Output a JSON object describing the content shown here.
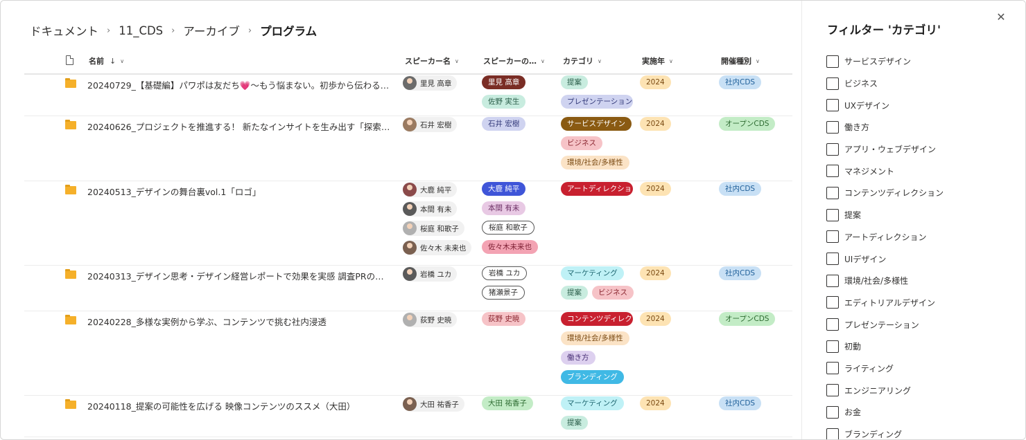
{
  "breadcrumb": [
    "ドキュメント",
    "11_CDS",
    "アーカイブ",
    "プログラム"
  ],
  "columns": {
    "name": "名前",
    "speaker": "スピーカー名",
    "speaker2": "スピーカーの…",
    "category": "カテゴリ",
    "year": "実施年",
    "type": "開催種別"
  },
  "icons": {
    "sort": "arrow-down-icon",
    "chevron": "chevron-down-icon",
    "file": "file-icon",
    "folder": "folder-icon",
    "close": "close-icon"
  },
  "colors": {
    "brown": "#7a2d25",
    "mint": "#c8ecdf",
    "lavender": "#cfd3f0",
    "gold": "#8a5a12",
    "pink": "#f6c3c7",
    "peach": "#fbe3c6",
    "red": "#c8202f",
    "blue": "#3f55d8",
    "mauve": "#e8c9e4",
    "rose": "#f3a3b3",
    "cyan": "#bff1f6",
    "teal": "#40b9e5",
    "lightblue": "#c8e0f5",
    "green": "#c3ecc6",
    "yellow": "#fde3b3",
    "lilac": "#ddd0ef"
  },
  "rows": [
    {
      "name": "20240729_【基礎編】パワポは友だち💗〜もう悩まない。初歩から伝わる資料作成術〜",
      "speakers": [
        "里見 高章"
      ],
      "speakers2": [
        {
          "label": "里見 高章",
          "bg": "#7a2d25",
          "fg": "#ffffff"
        },
        {
          "label": "佐野 実生",
          "bg": "#c8ecdf",
          "fg": "#2b5e4a"
        }
      ],
      "categories": [
        {
          "label": "提案",
          "bg": "#c8ecdf",
          "fg": "#2b5e4a"
        },
        {
          "label": "プレゼンテーション",
          "bg": "#cfd3f0",
          "fg": "#333a7a"
        }
      ],
      "year": "2024",
      "type": "社内CDS",
      "type_bg": "#c8e0f5",
      "type_fg": "#1f5f99"
    },
    {
      "name": "20240626_プロジェクトを推進する！ 新たなインサイトを生み出す「探索型リサーチ」",
      "speakers": [
        "石井 宏樹"
      ],
      "speakers2": [
        {
          "label": "石井 宏樹",
          "bg": "#cfd3f0",
          "fg": "#333a7a"
        }
      ],
      "categories": [
        {
          "label": "サービスデザイン",
          "bg": "#8a5a12",
          "fg": "#ffffff"
        },
        {
          "label": "ビジネス",
          "bg": "#f6c3c7",
          "fg": "#8a2630"
        },
        {
          "label": "環境/社会/多様性",
          "bg": "#fbe3c6",
          "fg": "#7a4a12"
        }
      ],
      "year": "2024",
      "type": "オープンCDS",
      "type_bg": "#c3ecc6",
      "type_fg": "#2d6b31"
    },
    {
      "name": "20240513_デザインの舞台裏vol.1「ロゴ」",
      "speakers": [
        "大鹿 純平",
        "本間 有未",
        "桜庭 和歌子",
        "佐々木 未来也"
      ],
      "speakers2": [
        {
          "label": "大鹿 純平",
          "bg": "#3f55d8",
          "fg": "#ffffff"
        },
        {
          "label": "本間 有未",
          "bg": "#e8c9e4",
          "fg": "#6b2e63"
        },
        {
          "label": "桜庭 和歌子",
          "bg": "outline",
          "fg": "#323130"
        },
        {
          "label": "佐々木未来也",
          "bg": "#f3a3b3",
          "fg": "#7d1f33"
        }
      ],
      "categories": [
        {
          "label": "アートディレクション",
          "bg": "#c8202f",
          "fg": "#ffffff"
        }
      ],
      "year": "2024",
      "type": "社内CDS",
      "type_bg": "#c8e0f5",
      "type_fg": "#1f5f99"
    },
    {
      "name": "20240313_デザイン思考・デザイン経営レポートで効果を実感 調査PRの可能性",
      "speakers": [
        "岩橋 ユカ"
      ],
      "speakers2": [
        {
          "label": "岩橋 ユカ",
          "bg": "outline",
          "fg": "#323130"
        },
        {
          "label": "猪瀬景子",
          "bg": "outline",
          "fg": "#323130"
        }
      ],
      "categories": [
        {
          "label": "マーケティング",
          "bg": "#bff1f6",
          "fg": "#1e6670"
        },
        {
          "label": "提案",
          "bg": "#c8ecdf",
          "fg": "#2b5e4a"
        },
        {
          "label": "ビジネス",
          "bg": "#f6c3c7",
          "fg": "#8a2630"
        }
      ],
      "categories_inline_last": true,
      "year": "2024",
      "type": "社内CDS",
      "type_bg": "#c8e0f5",
      "type_fg": "#1f5f99"
    },
    {
      "name": "20240228_多様な実例から学ぶ、コンテンツで挑む社内浸透",
      "speakers": [
        "荻野 史暁"
      ],
      "speakers2": [
        {
          "label": "荻野 史暁",
          "bg": "#f6c3c7",
          "fg": "#8a2630"
        }
      ],
      "categories": [
        {
          "label": "コンテンツディレクション",
          "bg": "#c8202f",
          "fg": "#ffffff"
        },
        {
          "label": "環境/社会/多様性",
          "bg": "#fbe3c6",
          "fg": "#7a4a12"
        },
        {
          "label": "働き方",
          "bg": "#ddd0ef",
          "fg": "#4b3378"
        },
        {
          "label": "ブランディング",
          "bg": "#40b9e5",
          "fg": "#ffffff"
        }
      ],
      "year": "2024",
      "type": "オープンCDS",
      "type_bg": "#c3ecc6",
      "type_fg": "#2d6b31"
    },
    {
      "name": "20240118_提案の可能性を広げる 映像コンテンツのススメ（大田）",
      "speakers": [
        "大田 祐香子"
      ],
      "speakers2": [
        {
          "label": "大田 祐香子",
          "bg": "#c3ecc6",
          "fg": "#2d6b31"
        }
      ],
      "categories": [
        {
          "label": "マーケティング",
          "bg": "#bff1f6",
          "fg": "#1e6670"
        },
        {
          "label": "提案",
          "bg": "#c8ecdf",
          "fg": "#2b5e4a"
        }
      ],
      "year": "2024",
      "type": "社内CDS",
      "type_bg": "#c8e0f5",
      "type_fg": "#1f5f99"
    }
  ],
  "panel": {
    "title": "フィルター 'カテゴリ'",
    "close_label": "✕",
    "options": [
      "サービスデザイン",
      "ビジネス",
      "UXデザイン",
      "働き方",
      "アプリ・ウェブデザイン",
      "マネジメント",
      "コンテンツディレクション",
      "提案",
      "アートディレクション",
      "UIデザイン",
      "環境/社会/多様性",
      "エディトリアルデザイン",
      "プレゼンテーション",
      "初動",
      "ライティング",
      "エンジニアリング",
      "お金",
      "ブランディング"
    ]
  },
  "year_pill": {
    "bg": "#fde3b3",
    "fg": "#7a4a12"
  }
}
